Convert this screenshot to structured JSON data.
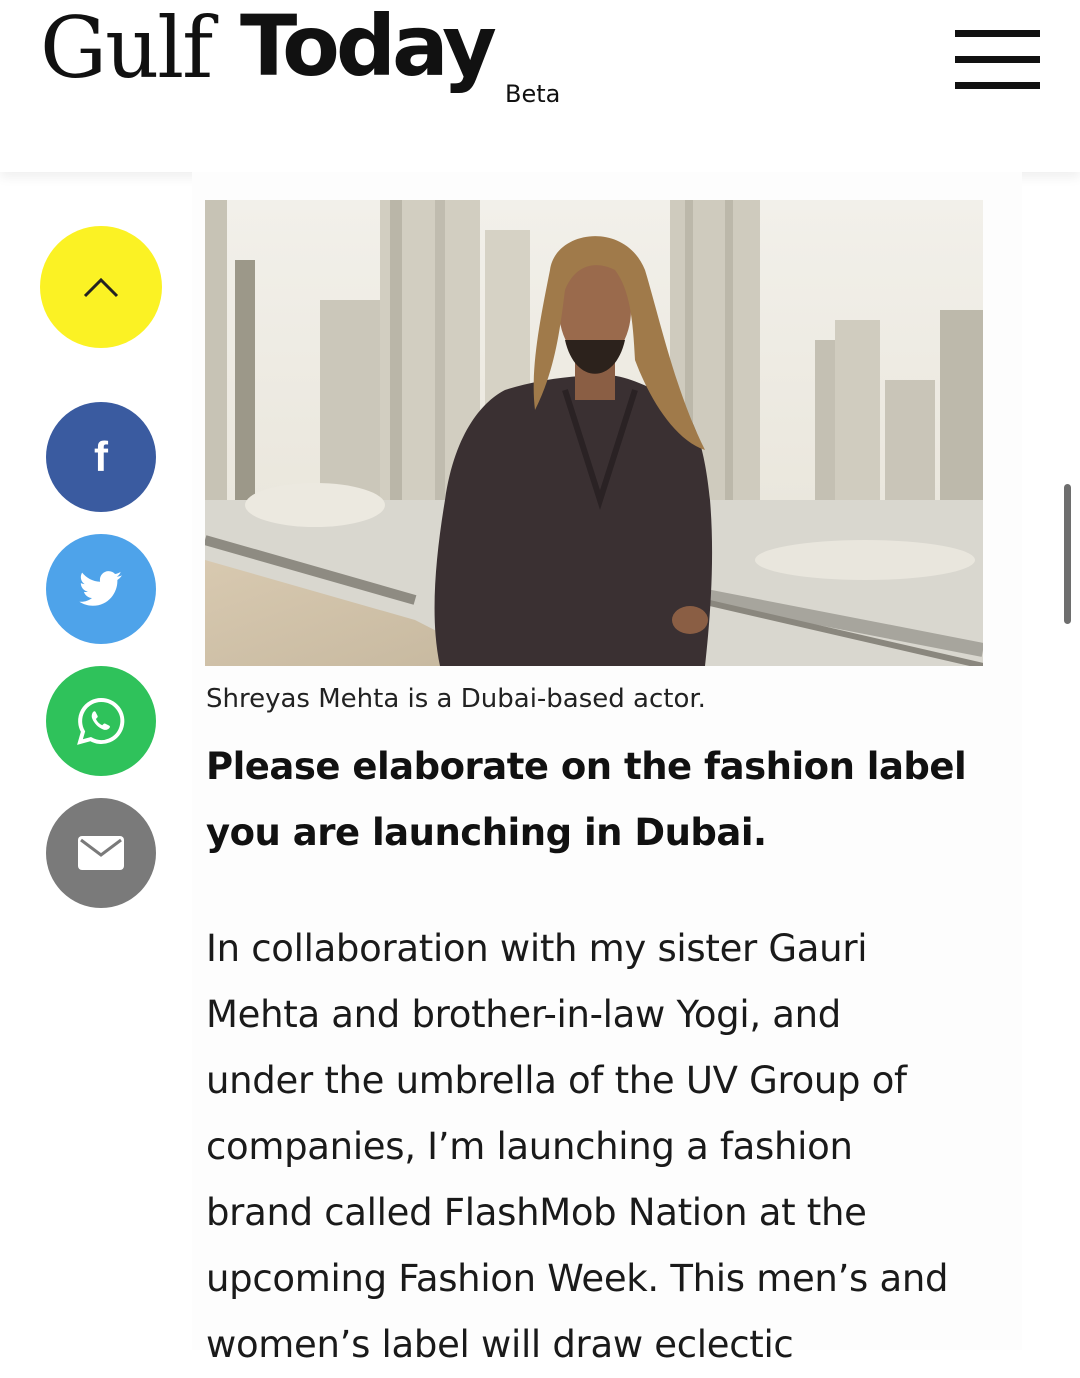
{
  "header": {
    "logo_word1": "Gulf",
    "logo_word2": "Today",
    "logo_badge": "Beta",
    "menu_icon": "hamburger-menu-icon"
  },
  "share_bar": {
    "items": [
      {
        "name": "scroll-to-top",
        "icon": "chevron-up-icon",
        "color": "#fbf224"
      },
      {
        "name": "facebook",
        "icon": "facebook-icon",
        "glyph": "f",
        "color": "#3a5ba0"
      },
      {
        "name": "twitter",
        "icon": "twitter-bird-icon",
        "color": "#4ea3ea"
      },
      {
        "name": "whatsapp",
        "icon": "whatsapp-icon",
        "color": "#2fc25b"
      },
      {
        "name": "email",
        "icon": "envelope-icon",
        "color": "#7a7a7a"
      }
    ]
  },
  "article": {
    "caption": "Shreyas Mehta is a Dubai-based actor.",
    "question_lines": [
      "Please elaborate on the fashion label",
      "you are launching in Dubai."
    ],
    "answer_lines": [
      "In collaboration with my sister Gauri",
      "Mehta and brother-in-law Yogi, and",
      "under the umbrella of the UV Group of",
      "companies, I’m launching a fashion",
      "brand called FlashMob Nation at the",
      "upcoming Fashion Week. This men’s and",
      "women’s label will draw eclectic"
    ]
  }
}
